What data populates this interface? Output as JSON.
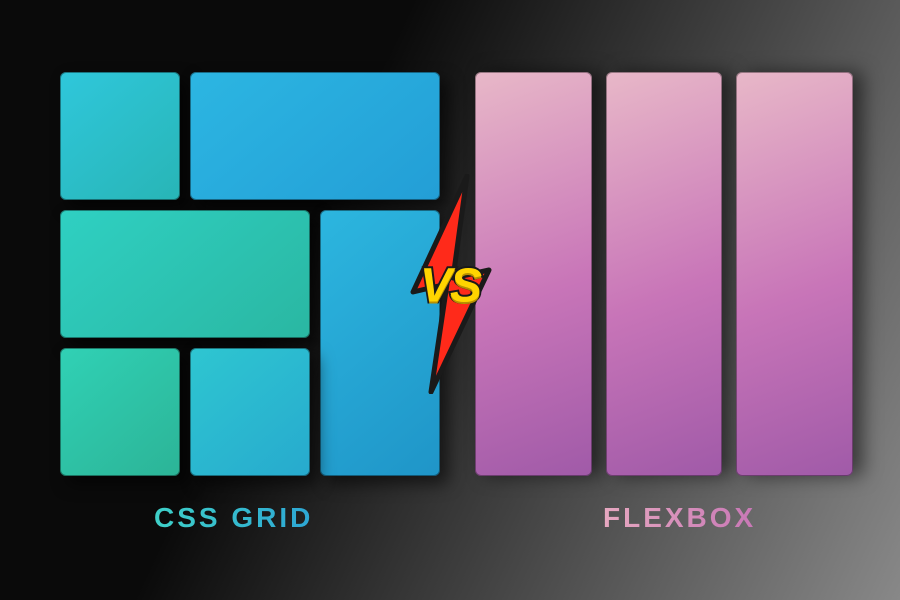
{
  "labels": {
    "left": "CSS GRID",
    "right": "FLEXBOX",
    "vs": "VS"
  },
  "icons": {
    "versus": "lightning-bolt-icon"
  },
  "colors": {
    "grid_accent": "#2bc4d0",
    "flex_accent": "#c87ab5",
    "vs_fill": "#ffd400",
    "bolt_fill": "#ff2a1a"
  }
}
